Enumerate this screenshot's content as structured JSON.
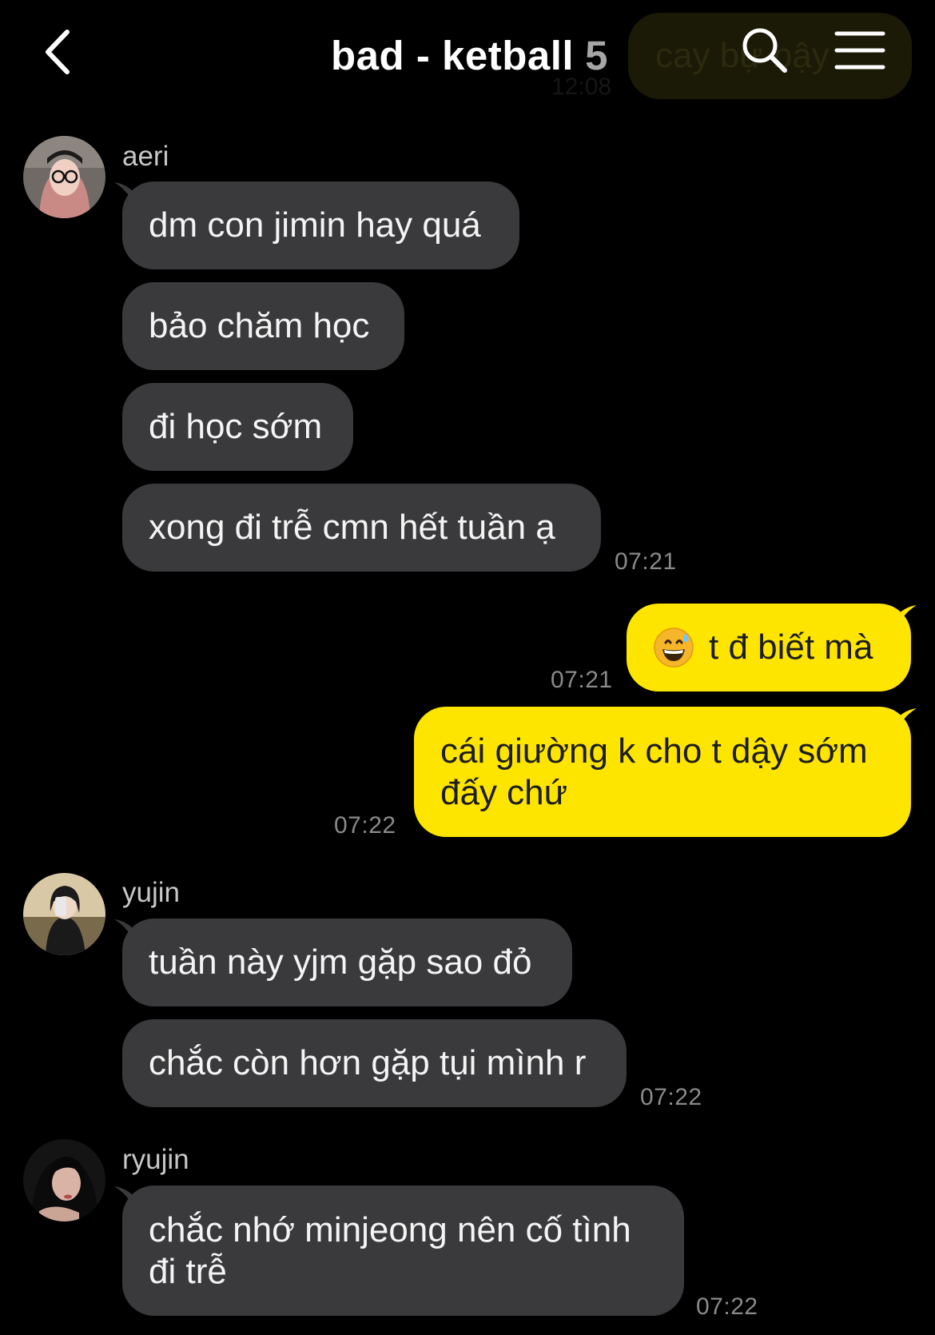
{
  "header": {
    "title": "bad - ketball",
    "member_count": "5",
    "ghost_message": "cay bự bậy",
    "ghost_time": "12:08"
  },
  "icons": {
    "back": "chevron-left-icon",
    "search": "search-icon",
    "menu": "hamburger-menu-icon",
    "emoji": "grinning-face-with-sweat-emoji"
  },
  "colors": {
    "background": "#000000",
    "incoming_bubble": "#3a3a3c",
    "outgoing_bubble": "#fee500",
    "timestamp": "#8a8a8a",
    "sender_name": "#c7c7c7"
  },
  "messages": {
    "aeri": {
      "sender": "aeri",
      "m1": "dm con jimin hay quá",
      "m2": "bảo chăm học",
      "m3": "đi học sớm",
      "m4": "xong đi trễ cmn hết tuần ạ",
      "time": "07:21"
    },
    "me": {
      "m1": "t đ biết mà",
      "m1_time": "07:21",
      "m2": "cái giường k cho t dậy sớm đấy chứ",
      "m2_time": "07:22"
    },
    "yujin": {
      "sender": "yujin",
      "m1": "tuần này yjm gặp sao đỏ",
      "m2": "chắc còn hơn gặp tụi mình r",
      "time": "07:22"
    },
    "ryujin": {
      "sender": "ryujin",
      "m1": "chắc nhớ minjeong nên cố tình đi trễ",
      "time": "07:22"
    }
  }
}
